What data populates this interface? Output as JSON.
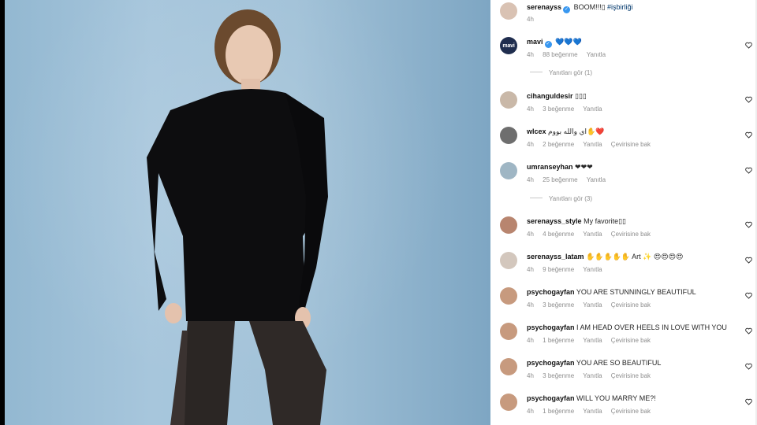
{
  "comments": [
    {
      "user": "serenayss",
      "verified": true,
      "text": "BOOM!!!▯",
      "hashtag": "#işbirliği",
      "time": "4h",
      "likes": "",
      "reply": "",
      "translate": ""
    },
    {
      "user": "mavi",
      "verified": true,
      "text": "💙💙💙",
      "time": "4h",
      "likes": "88 beğenme",
      "reply": "Yanıtla",
      "translate": ""
    },
    {
      "user": "cihanguldesir",
      "text": "▯▯▯",
      "time": "4h",
      "likes": "3 beğenme",
      "reply": "Yanıtla",
      "translate": ""
    },
    {
      "user": "wlcex",
      "text": "اي والله بووم✋❤️",
      "time": "4h",
      "likes": "2 beğenme",
      "reply": "Yanıtla",
      "translate": "Çevirisine bak"
    },
    {
      "user": "umranseyhan",
      "text": "❤❤❤",
      "time": "4h",
      "likes": "25 beğenme",
      "reply": "Yanıtla",
      "translate": ""
    },
    {
      "user": "serenayss_style",
      "text": "My favorite▯▯",
      "time": "4h",
      "likes": "4 beğenme",
      "reply": "Yanıtla",
      "translate": "Çevirisine bak"
    },
    {
      "user": "serenayss_latam",
      "text": "✋✋✋✋✋ Art ✨ 😍😍😍😍",
      "time": "4h",
      "likes": "9 beğenme",
      "reply": "Yanıtla",
      "translate": ""
    },
    {
      "user": "psychogayfan",
      "text": "YOU ARE STUNNINGLY BEAUTIFUL",
      "time": "4h",
      "likes": "3 beğenme",
      "reply": "Yanıtla",
      "translate": "Çevirisine bak"
    },
    {
      "user": "psychogayfan",
      "text": "I AM HEAD OVER HEELS IN LOVE WITH YOU",
      "time": "4h",
      "likes": "1 beğenme",
      "reply": "Yanıtla",
      "translate": "Çevirisine bak"
    },
    {
      "user": "psychogayfan",
      "text": "YOU ARE SO BEAUTIFUL",
      "time": "4h",
      "likes": "3 beğenme",
      "reply": "Yanıtla",
      "translate": "Çevirisine bak"
    },
    {
      "user": "psychogayfan",
      "text": "WILL YOU MARRY ME?!",
      "time": "4h",
      "likes": "1 beğenme",
      "reply": "Yanıtla",
      "translate": "Çevirisine bak"
    }
  ],
  "view_replies": [
    {
      "label": "Yanıtları gör (1)"
    },
    {
      "label": "Yanıtları gör (3)"
    }
  ],
  "avatars": {
    "mavi_label": "mavi"
  },
  "colors": {
    "accent": "#3897f0",
    "link": "#00376b",
    "muted": "#8e8e8e",
    "background_photo": "#a2c2d8"
  },
  "icons": {
    "like": "heart-outline-icon",
    "verified": "verified-badge-icon"
  }
}
